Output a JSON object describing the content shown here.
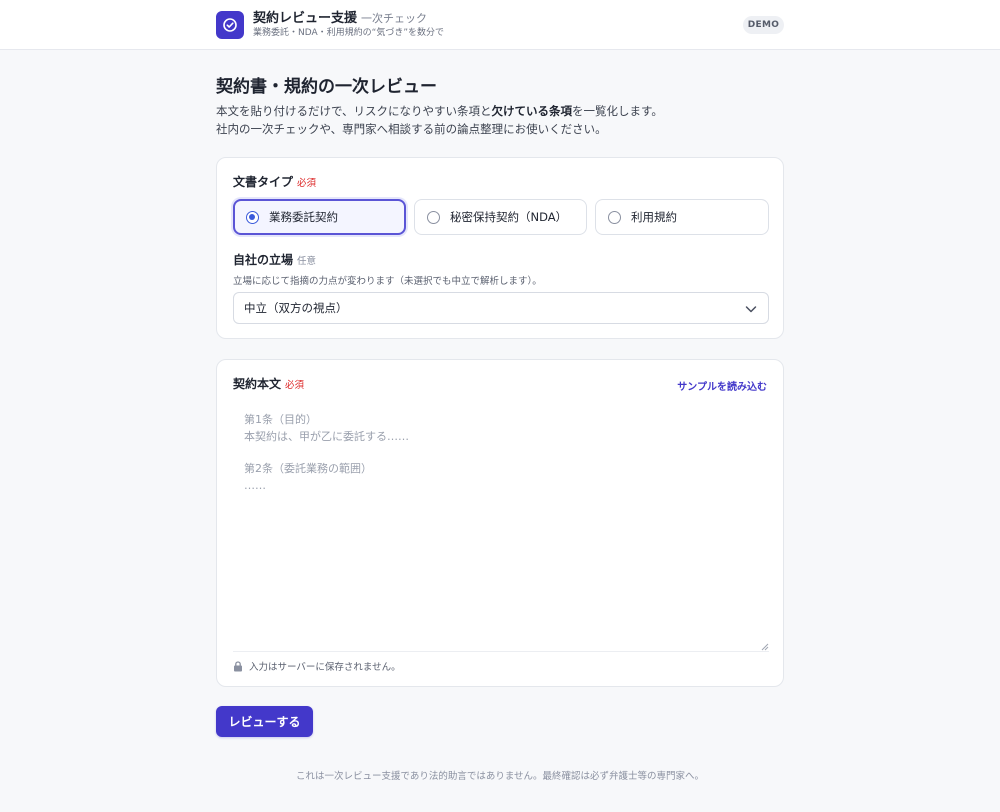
{
  "header": {
    "title": "契約レビュー支援",
    "subtitle": "一次チェック",
    "tagline": "業務委託・NDA・利用規約の“気づき”を数分で",
    "badge": "DEMO",
    "logo_icon": "check-circle-icon"
  },
  "intro": {
    "title": "契約書・規約の一次レビュー",
    "line1_part1": "本文を貼り付けるだけで、リスクになりやすい条項と",
    "line1_bold": "欠けている条項",
    "line1_part2": "を一覧化します。",
    "line2": "社内の一次チェックや、専門家へ相談する前の論点整理にお使いください。"
  },
  "doc_type": {
    "label": "文書タイプ",
    "required": "必須",
    "options": [
      {
        "label": "業務委託契約",
        "selected": true
      },
      {
        "label": "秘密保持契約（NDA）",
        "selected": false
      },
      {
        "label": "利用規約",
        "selected": false
      }
    ]
  },
  "position": {
    "label": "自社の立場",
    "optional": "任意",
    "hint": "立場に応じて指摘の力点が変わります（未選択でも中立で解析します）。",
    "selected": "中立（双方の視点）"
  },
  "contract_body": {
    "label": "契約本文",
    "required": "必須",
    "sample_link": "サンプルを読み込む",
    "placeholder_lines": [
      "第1条（目的）",
      "本契約は、甲が乙に委託する……",
      "第2条（委託業務の範囲）",
      "……"
    ],
    "privacy_note": "入力はサーバーに保存されません。"
  },
  "submit_label": "レビューする",
  "footer": "これは一次レビュー支援であり法的助言ではありません。最終確認は必ず弁護士等の専門家へ。",
  "colors": {
    "accent": "#4338ca",
    "required": "#dc2626",
    "selected_radio": "#3b5bdb"
  }
}
